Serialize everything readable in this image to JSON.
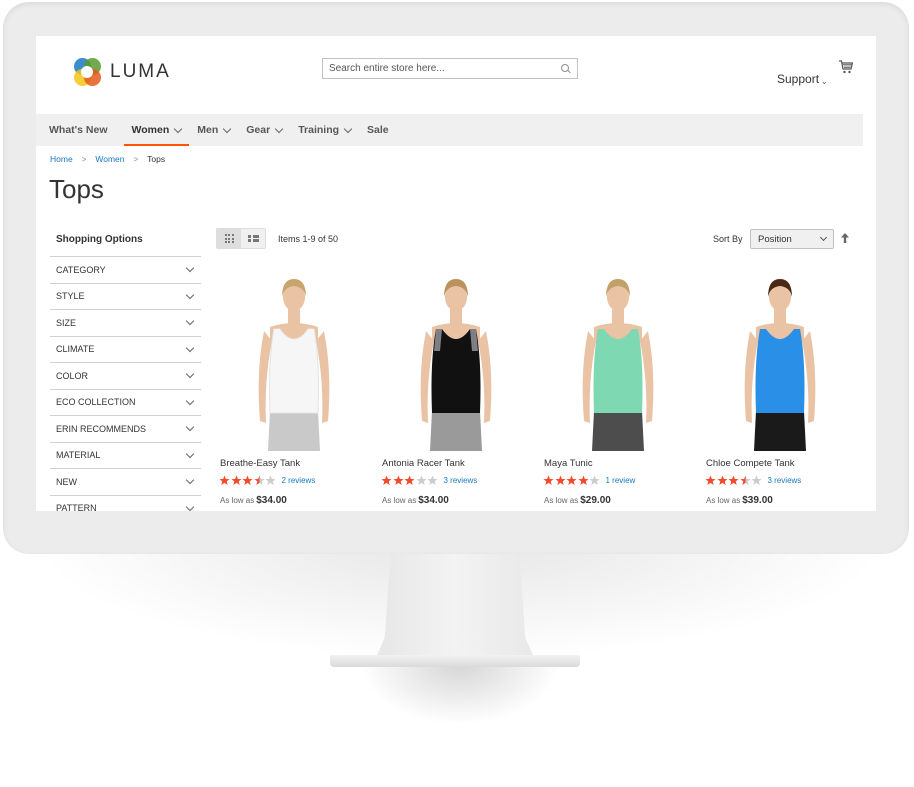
{
  "header": {
    "logo_text": "LUMA",
    "search_placeholder": "Search entire store here...",
    "support_label": "Support",
    "cart_icon": "cart-icon"
  },
  "nav": {
    "items": [
      {
        "label": "What's New",
        "has_dropdown": false,
        "active": false
      },
      {
        "label": "Women",
        "has_dropdown": true,
        "active": true
      },
      {
        "label": "Men",
        "has_dropdown": true,
        "active": false
      },
      {
        "label": "Gear",
        "has_dropdown": true,
        "active": false
      },
      {
        "label": "Training",
        "has_dropdown": true,
        "active": false
      },
      {
        "label": "Sale",
        "has_dropdown": false,
        "active": false
      }
    ]
  },
  "breadcrumb": {
    "items": [
      {
        "label": "Home",
        "link": true
      },
      {
        "label": "Women",
        "link": true
      },
      {
        "label": "Tops",
        "link": false
      }
    ],
    "separator": ">"
  },
  "page_title": "Tops",
  "sidebar": {
    "title": "Shopping Options",
    "filters": [
      "Category",
      "Style",
      "Size",
      "Climate",
      "Color",
      "Eco Collection",
      "Erin Recommends",
      "Material",
      "New",
      "Pattern"
    ]
  },
  "toolbar": {
    "view_modes": [
      {
        "name": "grid",
        "active": true
      },
      {
        "name": "list",
        "active": false
      }
    ],
    "items_count": "Items 1-9 of 50",
    "sort_label": "Sort By",
    "sort_value": "Position",
    "sort_direction": "ascending"
  },
  "products": [
    {
      "name": "Breathe-Easy Tank",
      "rating": 3.5,
      "reviews": "2 reviews",
      "price_prefix": "As low as",
      "price": "$34.00",
      "top_color": "#f6f6f6",
      "bottom_color": "#c9c9c9",
      "strap_color": "#f6f6f6",
      "hair_color": "#c8a56e"
    },
    {
      "name": "Antonia Racer Tank",
      "rating": 3,
      "reviews": "3 reviews",
      "price_prefix": "As low as",
      "price": "$34.00",
      "top_color": "#111111",
      "bottom_color": "#9a9a9a",
      "strap_color": "#7d7f85",
      "hair_color": "#b9935b"
    },
    {
      "name": "Maya Tunic",
      "rating": 4,
      "reviews": "1 review",
      "price_prefix": "As low as",
      "price": "$29.00",
      "top_color": "#7ed8b2",
      "bottom_color": "#4d4d4d",
      "strap_color": "#7ed8b2",
      "hair_color": "#c2a06a"
    },
    {
      "name": "Chloe Compete Tank",
      "rating": 3.5,
      "reviews": "3 reviews",
      "price_prefix": "As low as",
      "price": "$39.00",
      "top_color": "#2a8fe6",
      "bottom_color": "#1a1a1a",
      "strap_color": "#2a8fe6",
      "hair_color": "#4a2a17"
    }
  ],
  "colors": {
    "accent": "#ff5501",
    "link": "#1979c3",
    "star_filled": "#f24a2a",
    "star_empty": "#cccccc",
    "nav_bg": "#f0f0f0"
  }
}
